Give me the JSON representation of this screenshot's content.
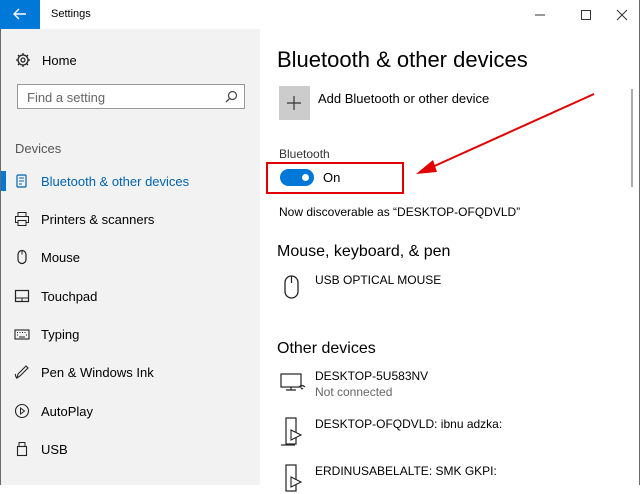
{
  "window": {
    "title": "Settings"
  },
  "sidebar": {
    "home_label": "Home",
    "search_placeholder": "Find a setting",
    "section_title": "Devices",
    "items": [
      {
        "label": "Bluetooth & other devices",
        "icon": "bluetooth-icon",
        "selected": true
      },
      {
        "label": "Printers & scanners",
        "icon": "printer-icon"
      },
      {
        "label": "Mouse",
        "icon": "mouse-icon"
      },
      {
        "label": "Touchpad",
        "icon": "touchpad-icon"
      },
      {
        "label": "Typing",
        "icon": "keyboard-icon"
      },
      {
        "label": "Pen & Windows Ink",
        "icon": "pen-icon"
      },
      {
        "label": "AutoPlay",
        "icon": "autoplay-icon"
      },
      {
        "label": "USB",
        "icon": "usb-icon"
      }
    ]
  },
  "main": {
    "title": "Bluetooth & other devices",
    "add_label": "Add Bluetooth or other device",
    "bluetooth_label": "Bluetooth",
    "bluetooth_state": "On",
    "discoverable_text": "Now discoverable as “DESKTOP-OFQDVLD”",
    "mouse_section": {
      "title": "Mouse, keyboard, & pen",
      "devices": [
        {
          "name": "USB OPTICAL MOUSE",
          "icon": "mouse-device-icon"
        }
      ]
    },
    "other_section": {
      "title": "Other devices",
      "devices": [
        {
          "name": "DESKTOP-5U583NV",
          "status": "Not connected",
          "icon": "pc-wireless-icon"
        },
        {
          "name": "DESKTOP-OFQDVLD: ibnu adzka:",
          "icon": "media-device-icon"
        },
        {
          "name": "ERDINUSABELALTE: SMK GKPI:",
          "icon": "media-device-icon"
        }
      ]
    }
  },
  "colors": {
    "accent": "#0078d7",
    "annotation": "#e00000",
    "sidebar_bg": "#f2f2f2"
  }
}
